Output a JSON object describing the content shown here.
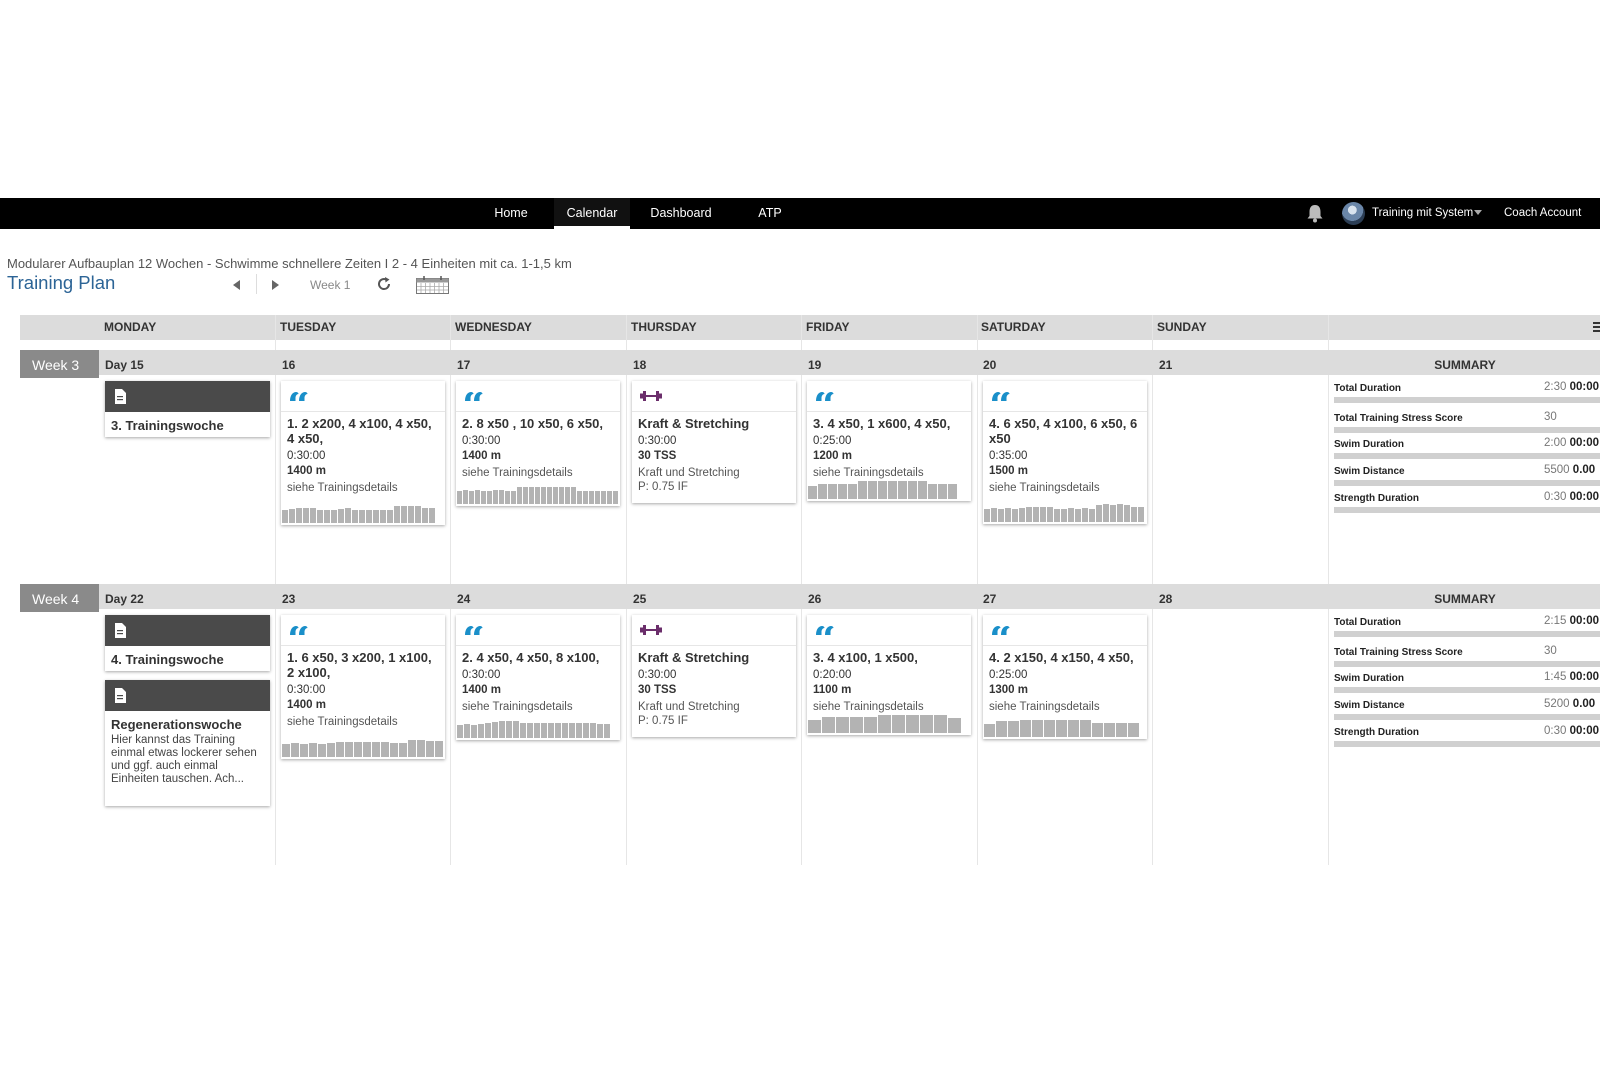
{
  "nav": {
    "tabs": [
      {
        "label": "Home",
        "active": false
      },
      {
        "label": "Calendar",
        "active": true
      },
      {
        "label": "Dashboard",
        "active": false
      },
      {
        "label": "ATP",
        "active": false
      }
    ],
    "user_name": "Training mit System",
    "coach_account": "Coach Account"
  },
  "header": {
    "plan_name": "Modularer Aufbauplan 12 Wochen - Schwimme schnellere Zeiten I 2 - 4 Einheiten mit ca. 1-1,5 km",
    "title": "Training Plan",
    "week_label": "Week 1"
  },
  "days": [
    "MONDAY",
    "TUESDAY",
    "WEDNESDAY",
    "THURSDAY",
    "FRIDAY",
    "SATURDAY",
    "SUNDAY"
  ],
  "colors": {
    "swim": "#1a8fc9",
    "strength": "#6b2e6b",
    "nav_bg": "#000000",
    "title": "#2c6496"
  },
  "weeks": [
    {
      "label": "Week 3",
      "day_numbers": [
        "Day 15",
        "16",
        "17",
        "18",
        "19",
        "20",
        "21"
      ],
      "summary_title": "SUMMARY",
      "notes": [
        {
          "title": "3. Trainingswoche",
          "text": ""
        }
      ],
      "workouts": [
        {
          "col": 1,
          "type": "swim-icon",
          "title": "1. 2 x200, 4 x100, 4 x50, 4 x50,",
          "duration": "0:30:00",
          "metric": "1400 m",
          "desc": "siehe Trainingsdetails",
          "ifv": "",
          "profile": [
            0.7,
            0.75,
            0.8,
            0.8,
            0.8,
            0.7,
            0.7,
            0.7,
            0.75,
            0.8,
            0.7,
            0.7,
            0.7,
            0.7,
            0.7,
            0.7,
            0.9,
            0.9,
            0.9,
            0.9,
            0.8,
            0.8
          ]
        },
        {
          "col": 2,
          "type": "swim-icon",
          "title": "2. 8 x50 , 10 x50, 6 x50,",
          "duration": "0:30:00",
          "metric": "1400 m",
          "desc": "siehe Trainingsdetails",
          "ifv": "",
          "profile": [
            0.7,
            0.75,
            0.7,
            0.75,
            0.7,
            0.7,
            0.75,
            0.75,
            0.7,
            0.7,
            0.9,
            0.9,
            0.9,
            0.9,
            0.9,
            0.9,
            0.9,
            0.9,
            0.9,
            0.9,
            0.7,
            0.7,
            0.7,
            0.7,
            0.7,
            0.7,
            0.7
          ]
        },
        {
          "col": 3,
          "type": "strength-icon",
          "title": "Kraft & Stretching",
          "duration": "0:30:00",
          "metric": "30 TSS",
          "desc": "Kraft und Stretching",
          "ifv": "P: 0.75 IF",
          "profile": []
        },
        {
          "col": 4,
          "type": "swim-icon",
          "title": "3. 4 x50, 1 x600, 4 x50,",
          "duration": "0:25:00",
          "metric": "1200 m",
          "desc": "siehe Trainingsdetails",
          "ifv": "",
          "profile": [
            0.7,
            0.8,
            0.8,
            0.8,
            0.8,
            0.95,
            0.95,
            0.95,
            0.95,
            0.95,
            0.95,
            0.95,
            0.8,
            0.8,
            0.8
          ]
        },
        {
          "col": 5,
          "type": "swim-icon",
          "title": "4. 6 x50, 4 x100, 6 x50, 6 x50",
          "duration": "0:35:00",
          "metric": "1500 m",
          "desc": "siehe Trainingsdetails",
          "ifv": "",
          "profile": [
            0.7,
            0.75,
            0.7,
            0.75,
            0.7,
            0.75,
            0.8,
            0.8,
            0.8,
            0.8,
            0.7,
            0.7,
            0.75,
            0.7,
            0.75,
            0.7,
            0.9,
            0.95,
            0.9,
            0.95,
            0.9,
            0.8,
            0.8
          ]
        }
      ],
      "summary": [
        {
          "label": "Total Duration",
          "planned": "2:30",
          "actual": "00:00"
        },
        {
          "label": "Total Training Stress Score",
          "planned": "30",
          "actual": ""
        },
        {
          "label": "Swim Duration",
          "planned": "2:00",
          "actual": "00:00"
        },
        {
          "label": "Swim Distance",
          "planned": "5500",
          "actual": "0.00"
        },
        {
          "label": "Strength Duration",
          "planned": "0:30",
          "actual": "00:00"
        }
      ]
    },
    {
      "label": "Week 4",
      "day_numbers": [
        "Day 22",
        "23",
        "24",
        "25",
        "26",
        "27",
        "28"
      ],
      "summary_title": "SUMMARY",
      "notes": [
        {
          "title": "4. Trainingswoche",
          "text": ""
        },
        {
          "title": "Regenerationswoche",
          "text": "Hier kannst das Training einmal etwas lockerer sehen und ggf. auch einmal Einheiten tauschen. Ach..."
        }
      ],
      "workouts": [
        {
          "col": 1,
          "type": "swim-icon",
          "title": "1. 6 x50, 3 x200, 1 x100, 2 x100,",
          "duration": "0:30:00",
          "metric": "1400 m",
          "desc": "siehe Trainingsdetails",
          "ifv": "",
          "profile": [
            0.7,
            0.75,
            0.7,
            0.75,
            0.7,
            0.75,
            0.8,
            0.8,
            0.8,
            0.8,
            0.8,
            0.8,
            0.75,
            0.75,
            0.9,
            0.9,
            0.85,
            0.85
          ]
        },
        {
          "col": 2,
          "type": "swim-icon",
          "title": "2. 4 x50, 4 x50, 8 x100,",
          "duration": "0:30:00",
          "metric": "1400 m",
          "desc": "siehe Trainingsdetails",
          "ifv": "",
          "profile": [
            0.7,
            0.75,
            0.7,
            0.75,
            0.8,
            0.85,
            0.9,
            0.9,
            0.9,
            0.8,
            0.8,
            0.8,
            0.8,
            0.8,
            0.8,
            0.8,
            0.8,
            0.8,
            0.8,
            0.8,
            0.75,
            0.75
          ]
        },
        {
          "col": 3,
          "type": "strength-icon",
          "title": "Kraft & Stretching",
          "duration": "0:30:00",
          "metric": "30 TSS",
          "desc": "Kraft und Stretching",
          "ifv": "P: 0.75 IF",
          "profile": []
        },
        {
          "col": 4,
          "type": "swim-icon",
          "title": "3. 4 x100, 1 x500,",
          "duration": "0:20:00",
          "metric": "1100 m",
          "desc": "siehe Trainingsdetails",
          "ifv": "",
          "profile": [
            0.7,
            0.85,
            0.85,
            0.85,
            0.85,
            0.95,
            0.95,
            0.95,
            0.95,
            0.95,
            0.8
          ]
        },
        {
          "col": 5,
          "type": "swim-icon",
          "title": "4. 2 x150, 4 x150, 4 x50,",
          "duration": "0:25:00",
          "metric": "1300 m",
          "desc": "siehe Trainingsdetails",
          "ifv": "",
          "profile": [
            0.7,
            0.85,
            0.85,
            0.9,
            0.9,
            0.9,
            0.9,
            0.9,
            0.9,
            0.75,
            0.75,
            0.75,
            0.75
          ]
        }
      ],
      "summary": [
        {
          "label": "Total Duration",
          "planned": "2:15",
          "actual": "00:00"
        },
        {
          "label": "Total Training Stress Score",
          "planned": "30",
          "actual": ""
        },
        {
          "label": "Swim Duration",
          "planned": "1:45",
          "actual": "00:00"
        },
        {
          "label": "Swim Distance",
          "planned": "5200",
          "actual": "0.00"
        },
        {
          "label": "Strength Duration",
          "planned": "0:30",
          "actual": "00:00"
        }
      ]
    }
  ]
}
